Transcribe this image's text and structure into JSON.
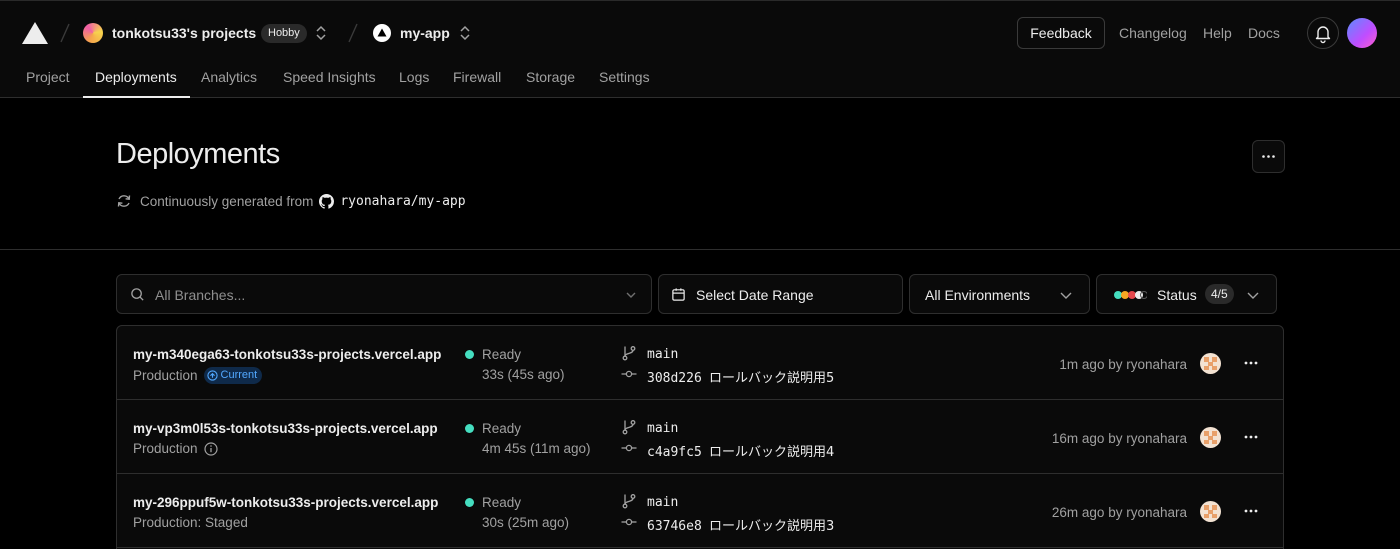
{
  "header": {
    "team_name": "tonkotsu33's projects",
    "plan_badge": "Hobby",
    "project_name": "my-app",
    "feedback_label": "Feedback",
    "links": [
      "Changelog",
      "Help",
      "Docs"
    ]
  },
  "tabs": [
    {
      "label": "Project",
      "active": false
    },
    {
      "label": "Deployments",
      "active": true
    },
    {
      "label": "Analytics",
      "active": false
    },
    {
      "label": "Speed Insights",
      "active": false
    },
    {
      "label": "Logs",
      "active": false
    },
    {
      "label": "Firewall",
      "active": false
    },
    {
      "label": "Storage",
      "active": false
    },
    {
      "label": "Settings",
      "active": false
    }
  ],
  "page": {
    "title": "Deployments",
    "source_prefix": "Continuously generated from",
    "repo": "ryonahara/my-app"
  },
  "filters": {
    "branch_placeholder": "All Branches...",
    "date_label": "Select Date Range",
    "env_label": "All Environments",
    "status_label": "Status",
    "status_count": "4/5"
  },
  "deployments": [
    {
      "url": "my-m340ega63-tonkotsu33s-projects.vercel.app",
      "env": "Production",
      "badge": "Current",
      "status": "Ready",
      "duration": "33s (45s ago)",
      "branch": "main",
      "commit_hash": "308d226",
      "commit_msg": "ロールバック説明用5",
      "ago": "1m ago by ryonahara"
    },
    {
      "url": "my-vp3m0l53s-tonkotsu33s-projects.vercel.app",
      "env": "Production",
      "badge": "",
      "status": "Ready",
      "duration": "4m 45s (11m ago)",
      "branch": "main",
      "commit_hash": "c4a9fc5",
      "commit_msg": "ロールバック説明用4",
      "ago": "16m ago by ryonahara"
    },
    {
      "url": "my-296ppuf5w-tonkotsu33s-projects.vercel.app",
      "env": "Production: Staged",
      "badge": "",
      "status": "Ready",
      "duration": "30s (25m ago)",
      "branch": "main",
      "commit_hash": "63746e8",
      "commit_msg": "ロールバック説明用3",
      "ago": "26m ago by ryonahara"
    }
  ],
  "colors": {
    "ready": "#45dec0",
    "current_badge": "#52a8ff"
  }
}
